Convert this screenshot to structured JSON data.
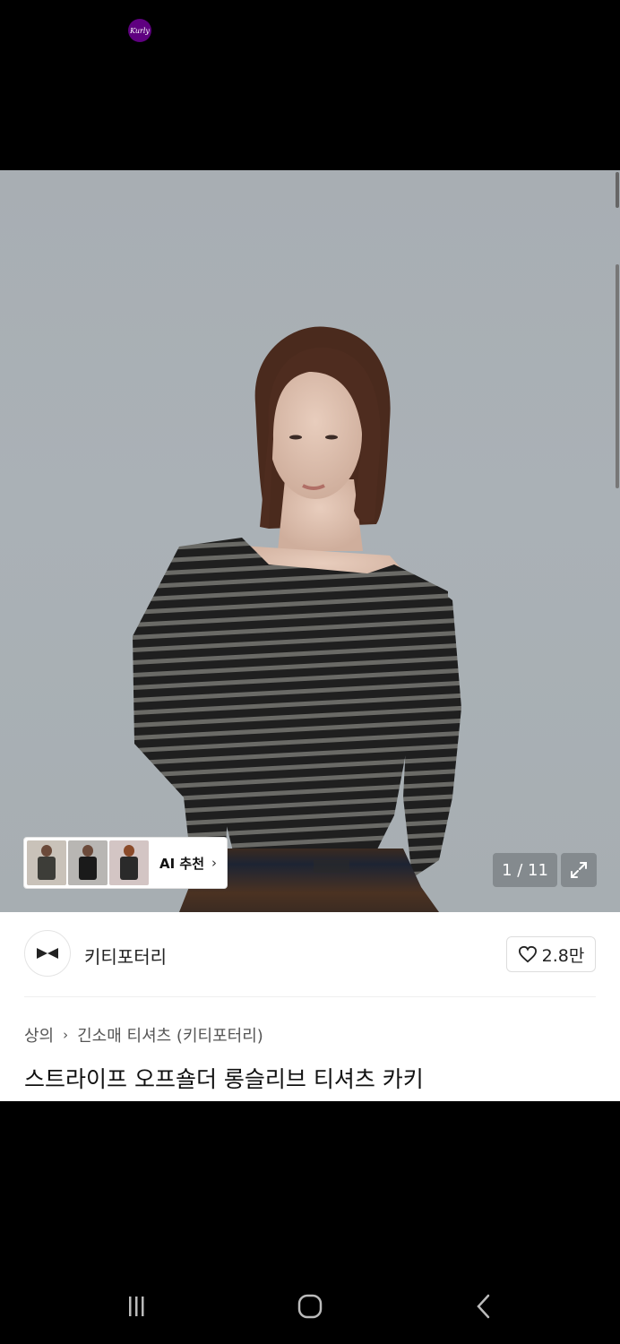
{
  "status_bar": {
    "kurly_badge": "Kurly"
  },
  "gallery": {
    "counter": "1 / 11",
    "ai_recommend_label": "AI 추천",
    "ai_chevron": "›",
    "expand_icon": "expand-icon"
  },
  "brand": {
    "name": "키티포터리",
    "likes": "2.8만"
  },
  "breadcrumb": {
    "category": "상의",
    "separator": "›",
    "subcategory": "긴소매 티셔츠 (키티포터리)"
  },
  "product": {
    "title": "스트라이프 오프숄더 롱슬리브 티셔츠 카키"
  },
  "colors": {
    "kurly_purple": "#5f0080",
    "backdrop": "#a9b0b5",
    "shirt_dark": "#1f1f1f",
    "shirt_stripe": "#6a6a66",
    "denim": "#1d2433"
  }
}
